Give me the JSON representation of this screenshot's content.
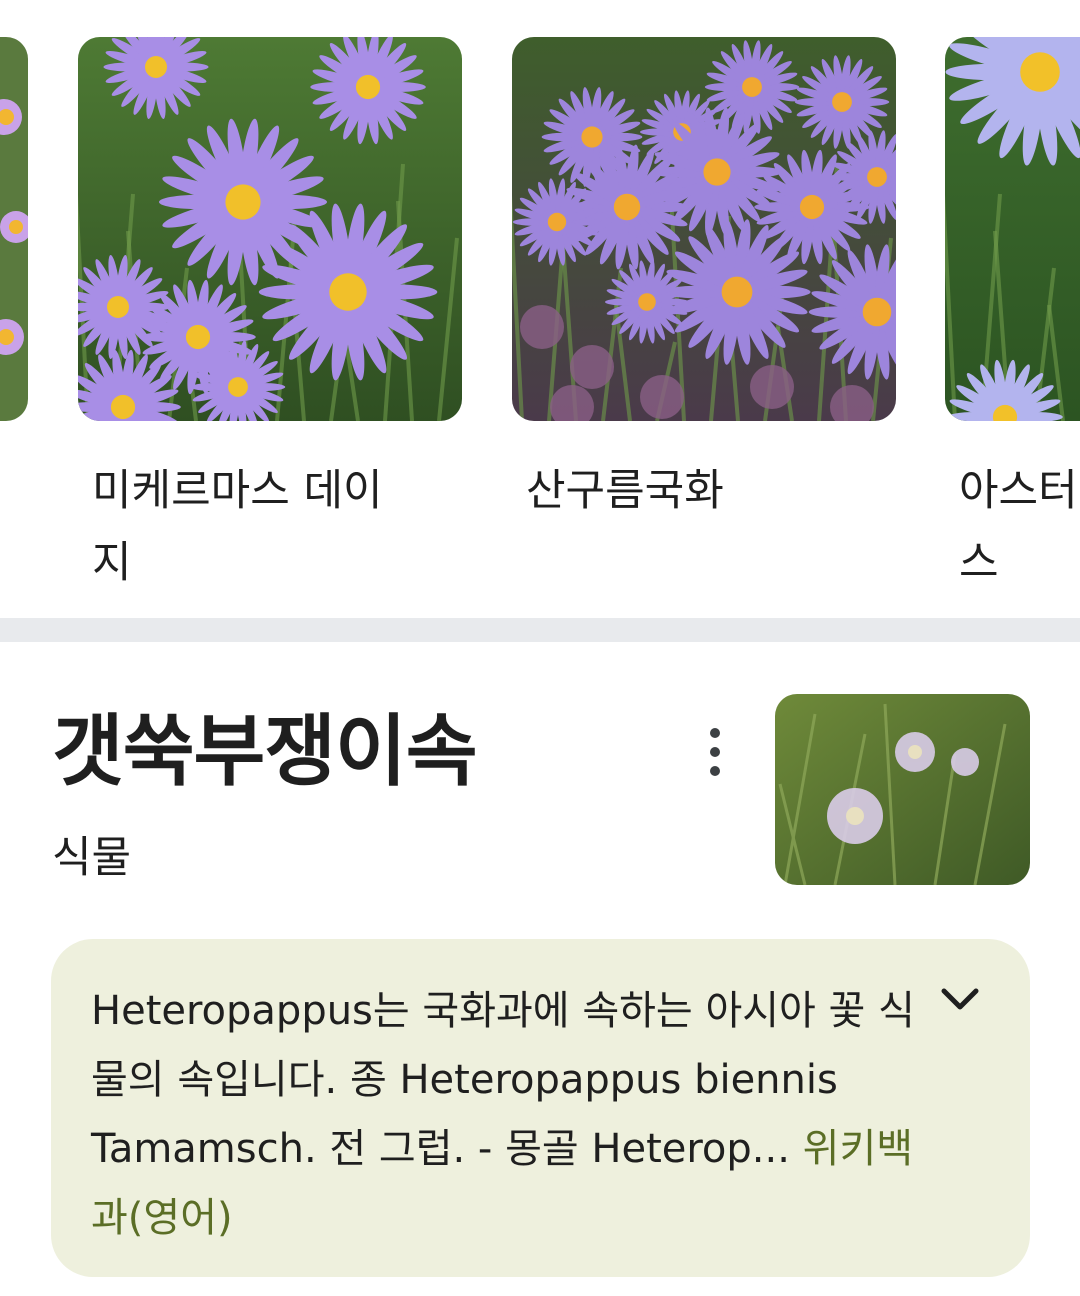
{
  "carousel": {
    "items": [
      {
        "label": "미케르마스 데이\n지",
        "image": "purple-aster-flowers-photo"
      },
      {
        "label": "산구름국화",
        "image": "purple-aster-meadow-photo"
      },
      {
        "label": "아스터\n스",
        "image": "blue-aster-flower-photo"
      }
    ]
  },
  "entity": {
    "title": "갯쑥부쟁이속",
    "subtitle": "식물",
    "thumbnail": "heteropappus-flower-photo",
    "menu_icon": "more-vert-icon"
  },
  "description": {
    "text": "Heteropappus는 국화과에 속하는 아시아 꽃 식물의 속입니다. 종 Heteropappus biennis Tamamsch. 전 그럽. - 몽골 Heterop... ",
    "source": "위키백과(영어)",
    "expand_icon": "chevron-down-icon"
  },
  "colors": {
    "description_bg": "#eef0dd",
    "source_link": "#5b6e26",
    "divider": "#e8eaed"
  }
}
